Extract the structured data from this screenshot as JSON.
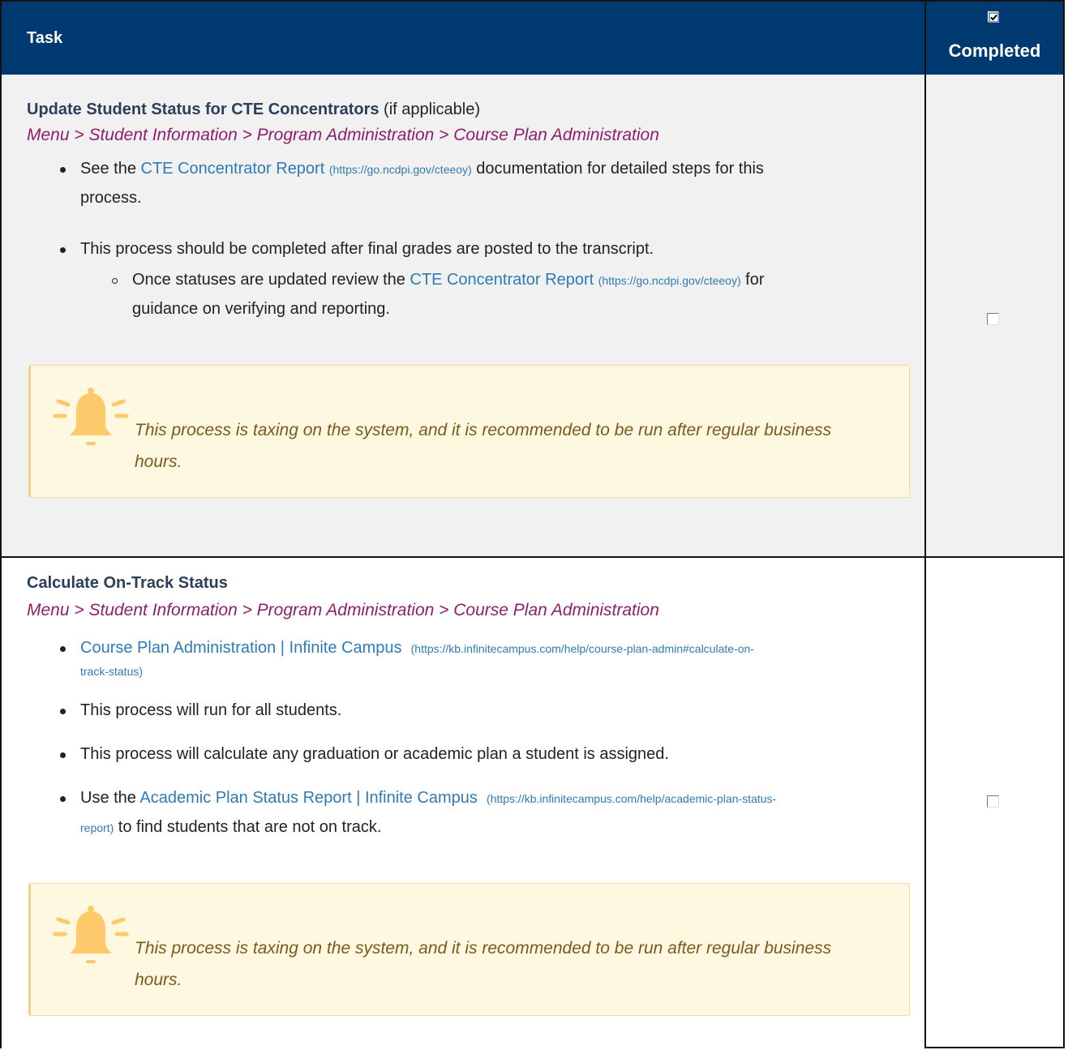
{
  "header": {
    "task_label": "Task",
    "completed_label": "Completed"
  },
  "rows": [
    {
      "title_bold": "Update Student Status for CTE Concentrators",
      "title_suffix": "(if applicable)",
      "path": "Menu > Student Information > Program Administration > Course Plan Administration",
      "items": [
        {
          "pre": "See the ",
          "link": "CTE Concentrator Report",
          "url": "(https://go.ncdpi.gov/cteeoy)",
          "post": " documentation for detailed steps for this",
          "post2": "process."
        },
        {
          "text": "This process should be completed after final grades are posted to the transcript."
        },
        {
          "pre": "Once statuses are updated review the ",
          "link": "CTE Concentrator Report",
          "url": "(https://go.ncdpi.gov/cteeoy)",
          "post": " for",
          "post2": "guidance on verifying and reporting."
        }
      ],
      "callout_line1": "This process is taxing on the system, and it is recommended to be run after regular business",
      "callout_line2": "hours.",
      "completed": false
    },
    {
      "title_bold": "Calculate On-Track Status",
      "path": "Menu > Student Information > Program Administration > Course Plan Administration",
      "items": [
        {
          "link": "Course Plan Administration | Infinite Campus",
          "url1": "(https://kb.infinitecampus.com/help/course-plan-admin#calculate-on-",
          "url2": "track-status)"
        },
        {
          "text": "This process will run for all students."
        },
        {
          "text": "This process will calculate any graduation or academic plan a student is assigned."
        },
        {
          "pre": "Use the ",
          "link": "Academic Plan Status Report | Infinite Campus",
          "url1": "(https://kb.infinitecampus.com/help/academic-plan-status-",
          "url2": "report)",
          "post": " to find students that are not on track."
        }
      ],
      "callout_line1": "This process is taxing on the system, and it is recommended to be run after regular business",
      "callout_line2": "hours.",
      "completed": false
    }
  ],
  "colors": {
    "header_bg": "#003a70",
    "path": "#8e1e6e",
    "link": "#2f7bb6",
    "callout_bg": "#fff8e0",
    "bell": "#fcc96b"
  }
}
